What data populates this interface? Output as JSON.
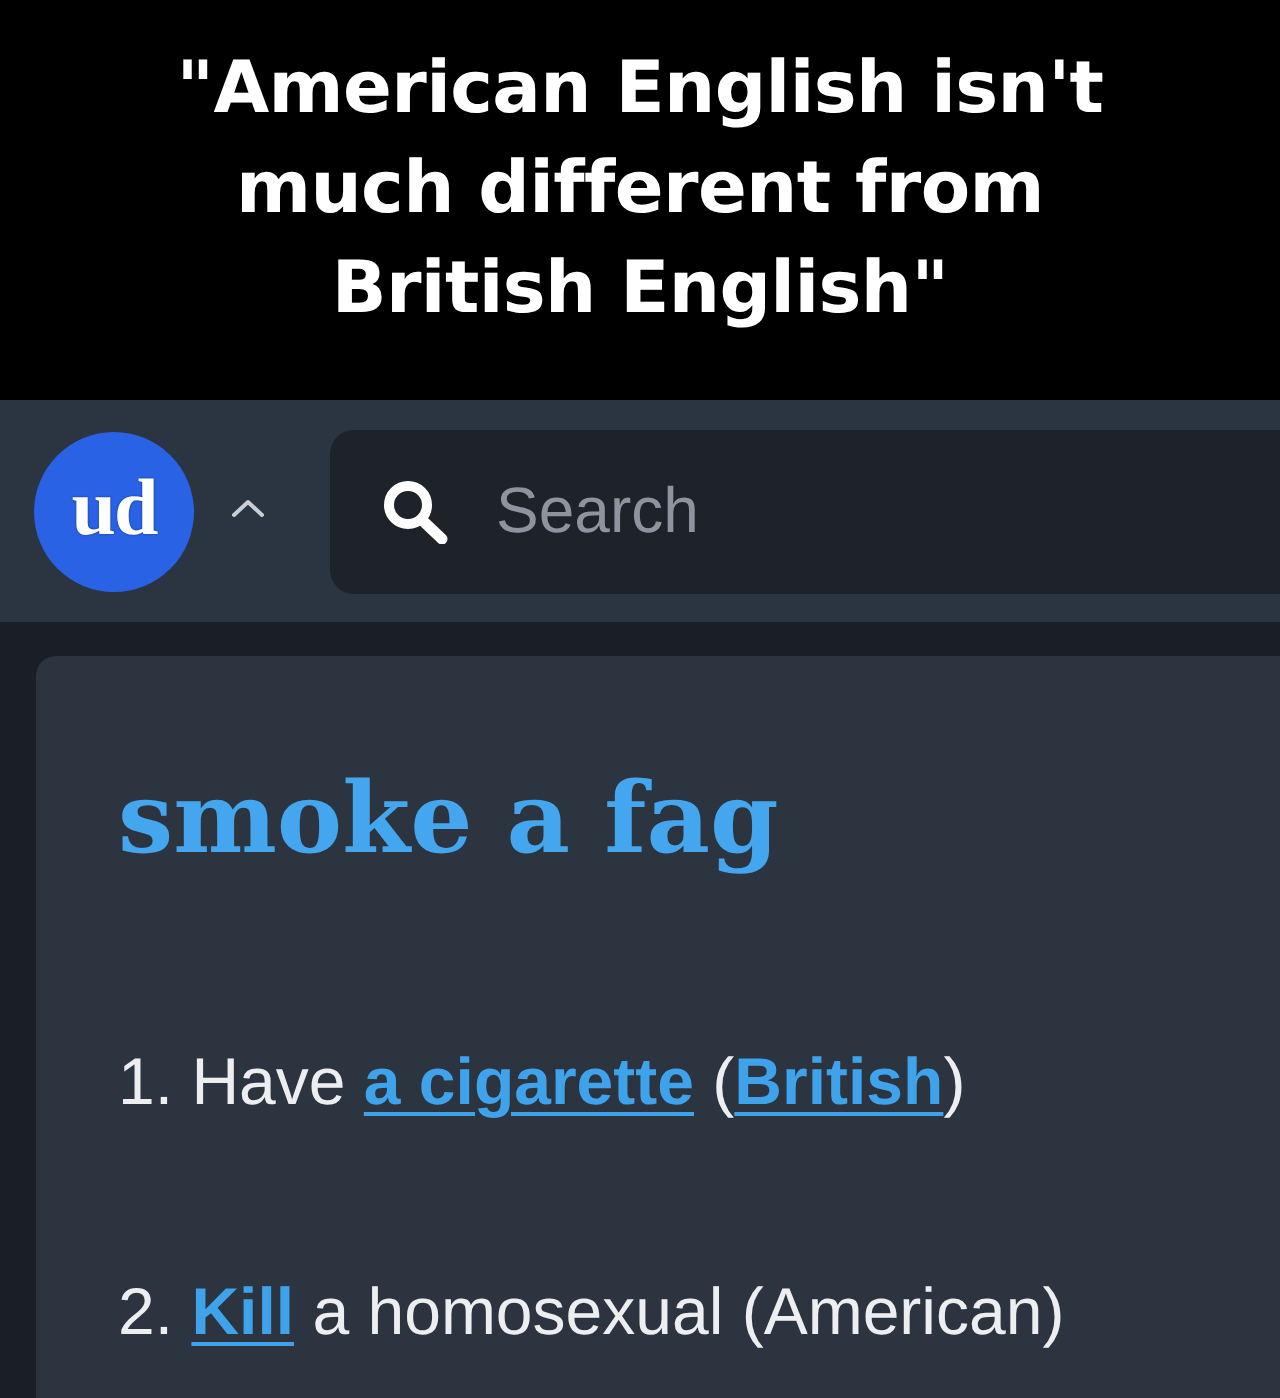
{
  "caption": {
    "text": "\"American English isn't much different from British English\""
  },
  "header": {
    "logo": {
      "text": "ud"
    },
    "search": {
      "placeholder": "Search"
    }
  },
  "entry": {
    "title": "smoke a fag",
    "definitions": [
      {
        "segments": [
          {
            "kind": "text",
            "text": "1. Have "
          },
          {
            "kind": "link",
            "text": "a cigarette"
          },
          {
            "kind": "text",
            "text": " ("
          },
          {
            "kind": "link",
            "text": "British"
          },
          {
            "kind": "text",
            "text": ")"
          }
        ]
      },
      {
        "segments": [
          {
            "kind": "text",
            "text": "2. "
          },
          {
            "kind": "link",
            "text": "Kill"
          },
          {
            "kind": "text",
            "text": " a homosexual (American)"
          }
        ]
      }
    ]
  }
}
